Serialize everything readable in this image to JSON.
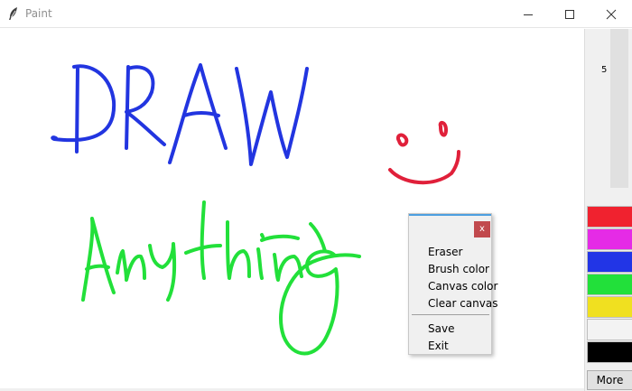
{
  "window": {
    "title": "Paint",
    "app_icon": "feather-icon",
    "controls": [
      "minimize-icon",
      "maximize-icon",
      "close-icon"
    ]
  },
  "canvas": {
    "background": "#ffffff",
    "strokes": [
      {
        "text": "DRAW",
        "color": "#2235e0"
      },
      {
        "text": "Anything",
        "color": "#22e03a"
      },
      {
        "text": "smiley face",
        "color": "#e0203a"
      }
    ]
  },
  "panel": {
    "brush_size": "5",
    "brush_size_value": 5,
    "colors": [
      "#f0222f",
      "#e52be6",
      "#2235e6",
      "#22e03a",
      "#f0e020",
      "#f3f3f3",
      "#000000"
    ],
    "more_label": "More"
  },
  "menu": {
    "close_label": "x",
    "items": [
      "Eraser",
      "Brush color",
      "Canvas color",
      "Clear canvas"
    ],
    "items2": [
      "Save",
      "Exit"
    ]
  }
}
